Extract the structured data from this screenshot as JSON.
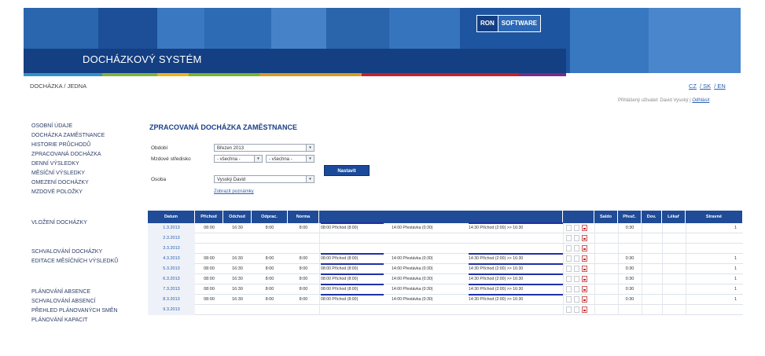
{
  "header": {
    "app_title": "DOCHÁZKOVÝ SYSTÉM",
    "logo_part1": "RON",
    "logo_part2": "SOFTWARE"
  },
  "breadcrumb": "DOCHÁZKA  / JEDNA",
  "languages": [
    "CZ",
    "/ SK",
    "/ EN"
  ],
  "user_line": {
    "prefix": "Přihlášený uživatel: David Vysoký | ",
    "logout": "Odhlásit"
  },
  "sidebar": {
    "items": [
      "OSOBNÍ ÚDAJE",
      "DOCHÁZKA ZAMĚSTNANCE",
      "HISTORIE PRŮCHODŮ",
      "ZPRACOVANÁ DOCHÁZKA",
      "DENNÍ VÝSLEDKY",
      "MĚSÍČNÍ VÝSLEDKY",
      "OMEZENÍ DOCHÁZKY",
      "MZDOVÉ POLOŽKY",
      "VLOŽENÍ DOCHÁZKY",
      "SCHVALOVÁNÍ DOCHÁZKY",
      "EDITACE MĚSÍČNÍCH VÝSLEDKŮ",
      "PLÁNOVÁNÍ ABSENCE",
      "SCHVALOVÁNÍ ABSENCÍ",
      "PŘEHLED PLÁNOVANÝCH SMĚN",
      "PLÁNOVÁNÍ KAPACIT"
    ]
  },
  "page_title": "ZPRACOVANÁ DOCHÁZKA ZAMĚSTNANCE",
  "filters": {
    "obdobi_label": "Období",
    "obdobi_value": "Březen 2013",
    "mzdove_label": "Mzdové středisko",
    "mzdove_value1": "- všechna -",
    "mzdove_value2": "- všechna -",
    "osoba_label": "Osoba",
    "osoba_value": "Vysoký David",
    "submit_label": "Nastavit",
    "extra_link": "Zobrazit poznámky"
  },
  "table": {
    "columns": [
      "Datum",
      "Příchod",
      "Odchod",
      "Odprac.",
      "Norma",
      "",
      "",
      "Saldo",
      "Přesč.",
      "Dov.",
      "Lékař",
      "Stravné"
    ],
    "rows": [
      {
        "date": "1.3.2013",
        "in": "08:00",
        "out": "16:30",
        "worked": "8:00",
        "norm": "8:00",
        "events": true,
        "overtime": "0:30",
        "meal": "1"
      },
      {
        "date": "2.3.2013",
        "in": "",
        "out": "",
        "worked": "",
        "norm": "",
        "events": false,
        "overtime": "",
        "meal": ""
      },
      {
        "date": "3.3.2013",
        "in": "",
        "out": "",
        "worked": "",
        "norm": "",
        "events": false,
        "overtime": "",
        "meal": ""
      },
      {
        "date": "4.3.2013",
        "in": "08:00",
        "out": "16:30",
        "worked": "8:00",
        "norm": "8:00",
        "events": true,
        "overtime": "0:30",
        "meal": "1"
      },
      {
        "date": "5.3.2013",
        "in": "08:00",
        "out": "16:30",
        "worked": "8:00",
        "norm": "8:00",
        "events": true,
        "overtime": "0:30",
        "meal": "1"
      },
      {
        "date": "6.3.2013",
        "in": "08:00",
        "out": "16:30",
        "worked": "8:00",
        "norm": "8:00",
        "events": true,
        "overtime": "0:30",
        "meal": "1"
      },
      {
        "date": "7.3.2013",
        "in": "08:00",
        "out": "16:30",
        "worked": "8:00",
        "norm": "8:00",
        "events": true,
        "overtime": "0:30",
        "meal": "1"
      },
      {
        "date": "8.3.2013",
        "in": "08:00",
        "out": "16:30",
        "worked": "8:00",
        "norm": "8:00",
        "events": true,
        "overtime": "0:30",
        "meal": "1"
      },
      {
        "date": "9.3.2013",
        "in": "",
        "out": "",
        "worked": "",
        "norm": "",
        "events": false,
        "overtime": "",
        "meal": ""
      }
    ],
    "events": [
      "08:00  Příchod (8:00)",
      "14:00  Přestávka (0:30)",
      "14:30  Příchod (2:00) >> 16:30"
    ]
  },
  "colors": {
    "banner": "#2f6eb8",
    "band": "#143f82",
    "accent": "#1f4b97"
  }
}
